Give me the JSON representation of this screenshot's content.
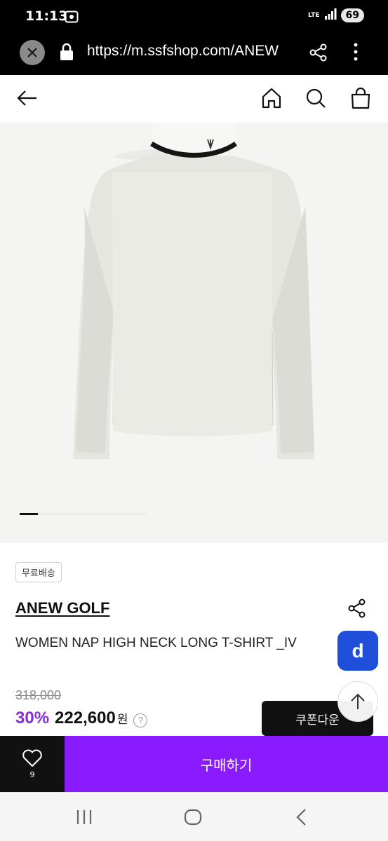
{
  "status_bar": {
    "time": "11:13",
    "network": "LTE",
    "battery": "69"
  },
  "browser": {
    "url": "https://m.ssfshop.com/ANEW"
  },
  "product": {
    "badge": "무료배송",
    "brand": "ANEW GOLF",
    "title": "WOMEN NAP HIGH NECK LONG T-SHIRT _IV",
    "original_price": "318,000",
    "discount": "30%",
    "sale_price": "222,600",
    "currency": "원",
    "help": "?"
  },
  "floating": {
    "d_label": "d"
  },
  "actions": {
    "coupon_label": "쿠폰다운",
    "wish_count": "9",
    "buy_label": "구매하기"
  },
  "image_slider": {
    "current": 1
  },
  "colors": {
    "accent": "#8a1bff",
    "discount": "#8a2be2",
    "d_button": "#1f4fd8"
  }
}
